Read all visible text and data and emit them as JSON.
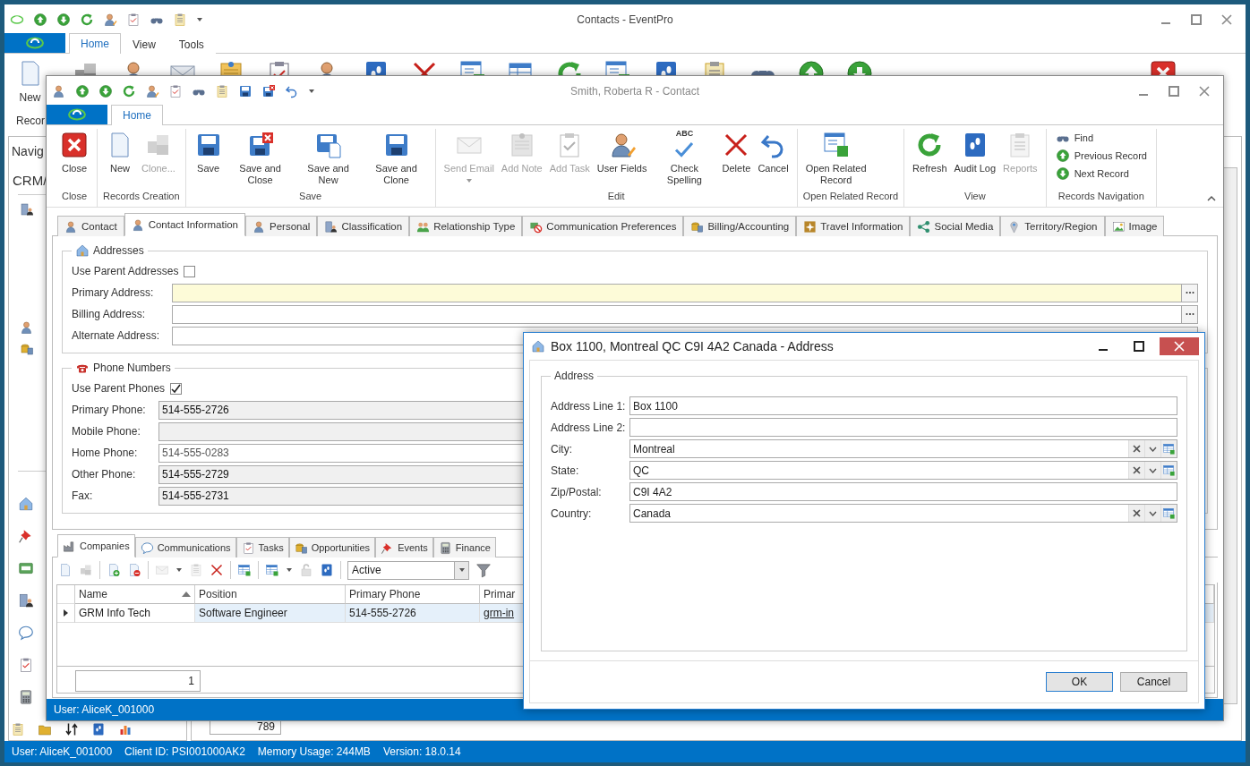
{
  "main_window": {
    "title": "Contacts - EventPro",
    "tabs": [
      {
        "label": "Home",
        "selected": true
      },
      {
        "label": "View",
        "selected": false
      },
      {
        "label": "Tools",
        "selected": false
      }
    ],
    "ribbon": {
      "button_label": "New",
      "group_label": "Recor"
    },
    "navigation": {
      "title": "Navig",
      "subtitle": "CRM/"
    },
    "count_field": "789",
    "status_bar": [
      "User: AliceK_001000",
      "Client ID: PSI001000AK2",
      "Memory Usage: 244MB",
      "Version: 18.0.14"
    ]
  },
  "contact_window": {
    "title": "Smith, Roberta R - Contact",
    "tabs": [
      {
        "label": "Home",
        "selected": true
      }
    ],
    "ribbon_groups": [
      {
        "label": "Close",
        "buttons": [
          {
            "label": "Close",
            "disabled": false
          }
        ]
      },
      {
        "label": "Records Creation",
        "buttons": [
          {
            "label": "New",
            "disabled": false
          },
          {
            "label": "Clone...",
            "disabled": true
          }
        ]
      },
      {
        "label": "Save",
        "buttons": [
          {
            "label": "Save",
            "disabled": false
          },
          {
            "label": "Save and Close",
            "disabled": false
          },
          {
            "label": "Save and New",
            "disabled": false
          },
          {
            "label": "Save and Clone",
            "disabled": false
          }
        ]
      },
      {
        "label": "Edit",
        "buttons": [
          {
            "label": "Send Email",
            "disabled": true,
            "dropdown": true
          },
          {
            "label": "Add Note",
            "disabled": true
          },
          {
            "label": "Add Task",
            "disabled": true
          },
          {
            "label": "User Fields",
            "disabled": false
          },
          {
            "label": "Check Spelling",
            "disabled": false,
            "icon_text": "ABC"
          },
          {
            "label": "Delete",
            "disabled": false
          },
          {
            "label": "Cancel",
            "disabled": false
          }
        ]
      },
      {
        "label": "Open Related Record",
        "buttons": [
          {
            "label": "Open Related Record",
            "disabled": false
          }
        ]
      },
      {
        "label": "View",
        "buttons": [
          {
            "label": "Refresh",
            "disabled": false
          },
          {
            "label": "Audit Log",
            "disabled": false
          },
          {
            "label": "Reports",
            "disabled": true
          }
        ]
      },
      {
        "label": "Records Navigation",
        "small_buttons": [
          "Find",
          "Previous Record",
          "Next Record"
        ]
      }
    ],
    "detail_tabs": [
      {
        "label": "Contact",
        "selected": false
      },
      {
        "label": "Contact Information",
        "selected": true
      },
      {
        "label": "Personal",
        "selected": false
      },
      {
        "label": "Classification",
        "selected": false
      },
      {
        "label": "Relationship Type",
        "selected": false
      },
      {
        "label": "Communication Preferences",
        "selected": false
      },
      {
        "label": "Billing/Accounting",
        "selected": false
      },
      {
        "label": "Travel Information",
        "selected": false
      },
      {
        "label": "Social Media",
        "selected": false
      },
      {
        "label": "Territory/Region",
        "selected": false
      },
      {
        "label": "Image",
        "selected": false
      }
    ],
    "addresses": {
      "title": "Addresses",
      "use_parent": {
        "label": "Use Parent Addresses",
        "checked": false
      },
      "fields": [
        {
          "label": "Primary Address:",
          "focused": true,
          "browse": true
        },
        {
          "label": "Billing Address:",
          "focused": false,
          "browse": true
        },
        {
          "label": "Alternate Address:",
          "focused": false,
          "browse": false
        }
      ]
    },
    "phones": {
      "title": "Phone Numbers",
      "use_parent": {
        "label": "Use Parent Phones",
        "checked": true
      },
      "fields": [
        {
          "label": "Primary Phone:",
          "value": "514-555-2726",
          "disabled": true
        },
        {
          "label": "Mobile Phone:",
          "disabled": true
        },
        {
          "label": "Home Phone:",
          "value": "514-555-0283",
          "disabled": false
        },
        {
          "label": "Other Phone:",
          "value": "514-555-2729",
          "disabled": true
        },
        {
          "label": "Fax:",
          "value": "514-555-2731",
          "disabled": true
        }
      ]
    },
    "bottom_tabs": [
      {
        "label": "Companies",
        "selected": true
      },
      {
        "label": "Communications",
        "selected": false
      },
      {
        "label": "Tasks",
        "selected": false
      },
      {
        "label": "Opportunities",
        "selected": false
      },
      {
        "label": "Events",
        "selected": false
      },
      {
        "label": "Finance",
        "selected": false
      }
    ],
    "filter": "Active",
    "grid": {
      "columns": [
        {
          "label": "Name",
          "sorted": true
        },
        {
          "label": "Position",
          "sorted": false
        },
        {
          "label": "Primary Phone",
          "sorted": false
        },
        {
          "label": "Primar",
          "sorted": false
        }
      ],
      "rows": [
        {
          "cells": [
            "GRM Info Tech",
            "Software Engineer",
            "514-555-2726",
            "grm-in"
          ],
          "selected": true
        }
      ],
      "count": "1"
    },
    "status_bar": "User: AliceK_001000"
  },
  "address_dialog": {
    "title": "Box 1100, Montreal QC C9I 4A2 Canada - Address",
    "group": "Address",
    "fields": [
      {
        "label": "Address Line 1:",
        "value": "Box 1100",
        "kind": "text"
      },
      {
        "label": "Address Line 2:",
        "kind": "text"
      },
      {
        "label": "City:",
        "value": "Montreal",
        "kind": "lookup"
      },
      {
        "label": "State:",
        "value": "QC",
        "kind": "lookup"
      },
      {
        "label": "Zip/Postal:",
        "value": "C9I 4A2",
        "kind": "text"
      },
      {
        "label": "Country:",
        "value": "Canada",
        "kind": "lookup"
      }
    ],
    "buttons": [
      {
        "label": "OK",
        "selected": true
      },
      {
        "label": "Cancel",
        "selected": false
      }
    ]
  }
}
